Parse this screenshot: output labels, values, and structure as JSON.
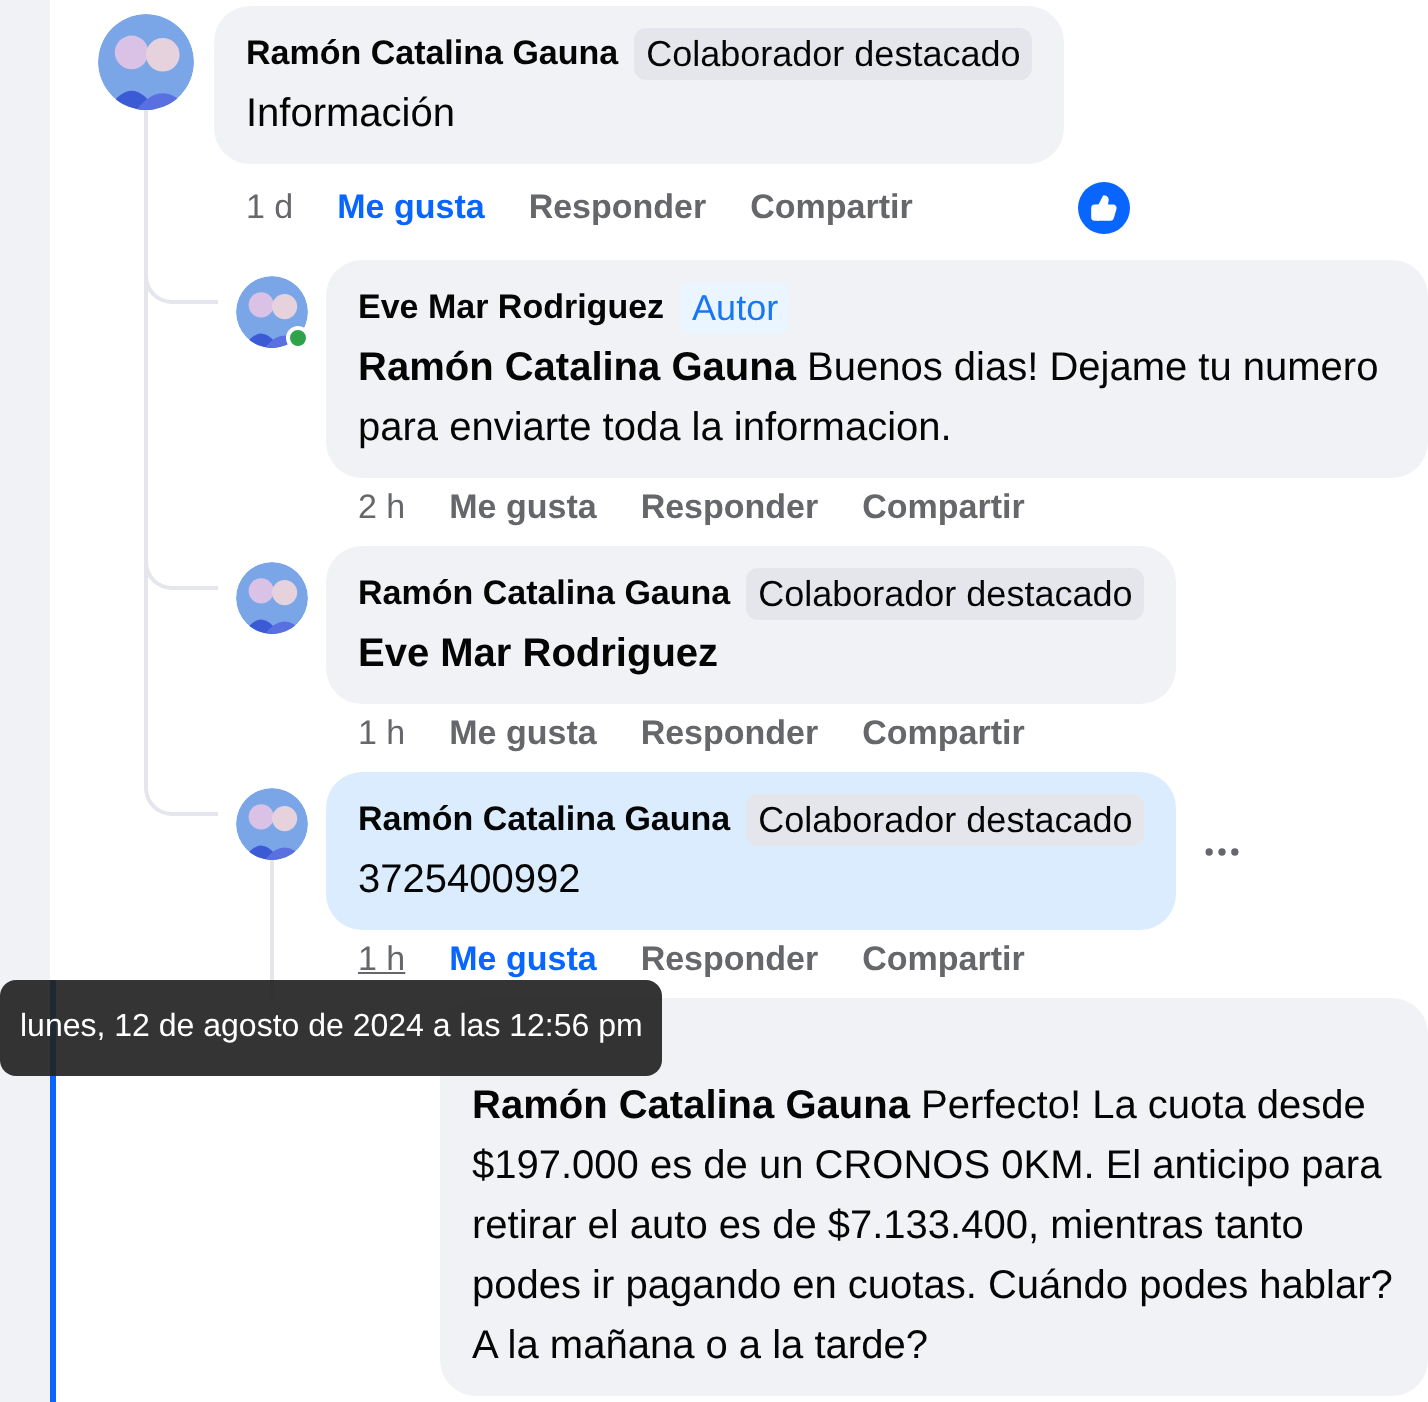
{
  "comments": [
    {
      "author": "Ramón Catalina Gauna",
      "badge": {
        "label": "Colaborador destacado",
        "kind": "contributor"
      },
      "text": "Información",
      "time": "1 d",
      "time_hover": false,
      "liked": true,
      "like_label": "Me gusta",
      "reply_label": "Responder",
      "share_label": "Compartir",
      "reaction": true,
      "children": [
        {
          "author": "Eve Mar Rodriguez",
          "badge": {
            "label": "Autor",
            "kind": "author"
          },
          "mention": "Ramón Catalina Gauna",
          "text": "Buenos dias! Dejame tu numero para enviarte toda la informacion.",
          "time": "2 h",
          "time_hover": false,
          "liked": false,
          "like_label": "Me gusta",
          "reply_label": "Responder",
          "share_label": "Compartir",
          "online": true
        },
        {
          "author": "Ramón Catalina Gauna",
          "badge": {
            "label": "Colaborador destacado",
            "kind": "contributor"
          },
          "mention": "Eve Mar Rodriguez",
          "time": "1 h",
          "time_hover": false,
          "liked": false,
          "like_label": "Me gusta",
          "reply_label": "Responder",
          "share_label": "Compartir"
        },
        {
          "author": "Ramón Catalina Gauna",
          "badge": {
            "label": "Colaborador destacado",
            "kind": "contributor"
          },
          "text": "3725400992",
          "time": "1 h",
          "time_hover": true,
          "liked": true,
          "like_label": "Me gusta",
          "reply_label": "Responder",
          "share_label": "Compartir",
          "highlighted": true,
          "more_menu": true,
          "children": [
            {
              "mention": "Ramón Catalina Gauna",
              "text": "Perfecto! La cuota desde $197.000 es de un CRONOS 0KM. El anticipo para retirar el auto es de $7.133.400, mientras tanto podes ir pagando en cuotas. Cuándo podes hablar? A la mañana o a la tarde?"
            }
          ]
        }
      ]
    }
  ],
  "tooltip": "lunes, 12 de agosto de 2024 a las 12:56 pm"
}
